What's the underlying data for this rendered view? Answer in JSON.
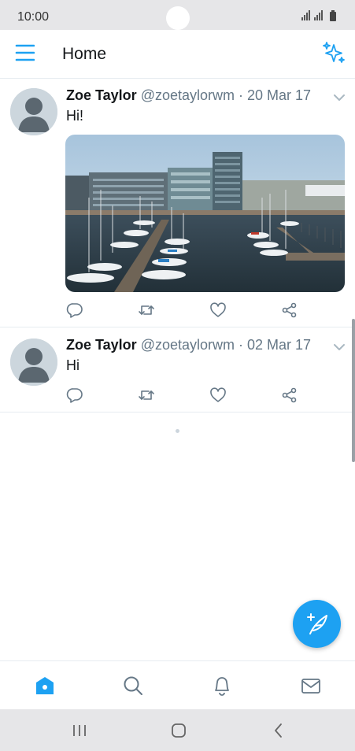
{
  "status_bar": {
    "time": "10:00"
  },
  "header": {
    "title": "Home",
    "menu_icon": "hamburger-menu-icon",
    "sparkle_icon": "sparkle-timeline-icon"
  },
  "tweets": [
    {
      "author_name": "Zoe Taylor",
      "handle": "@zoetaylorwm",
      "separator": " · ",
      "date": "20 Mar 17",
      "text": "Hi!",
      "has_media": true,
      "media_icon": "harbour-photo"
    },
    {
      "author_name": "Zoe Taylor",
      "handle": "@zoetaylorwm",
      "separator": " · ",
      "date": "02 Mar 17",
      "text": "Hi",
      "has_media": false
    }
  ],
  "actions": [
    "reply-icon",
    "retweet-icon",
    "like-icon",
    "share-icon"
  ],
  "fab": {
    "icon": "compose-tweet-icon"
  },
  "bottom_nav": [
    "home-icon",
    "search-icon",
    "notifications-icon",
    "messages-icon"
  ],
  "system_nav": [
    "recent-apps-icon",
    "home-button-icon",
    "back-icon"
  ],
  "colors": {
    "accent": "#1da1f2",
    "text": "#14171a",
    "secondary": "#657786",
    "avatar": "#ccd6dd"
  }
}
